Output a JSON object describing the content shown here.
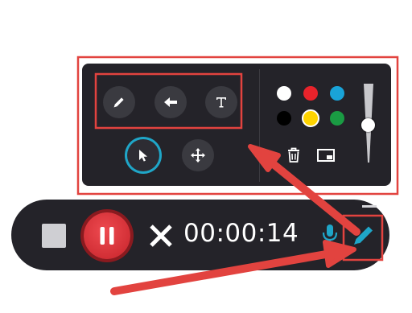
{
  "recorder": {
    "timer": "00:00:14",
    "state": "recording-paused-control-visible"
  },
  "drawing_tools": {
    "tools": [
      "pencil-icon",
      "arrow-icon",
      "text-icon",
      "pointer-icon",
      "move-icon"
    ],
    "selected_tool": "pointer-icon"
  },
  "palette": {
    "colors": [
      "#ffffff",
      "#e8232b",
      "#19a3d8",
      "#000000",
      "#ffd400",
      "#1a9b43"
    ],
    "selected_color": "#ffd400"
  },
  "stroke_size_level": 0.15,
  "colors": {
    "toolbar_bg": "#242329",
    "button_bg": "#3a3a40",
    "accent_blue": "#1fa6c8",
    "pause_red": "#e0343a",
    "annotation_red": "#e2433f"
  }
}
